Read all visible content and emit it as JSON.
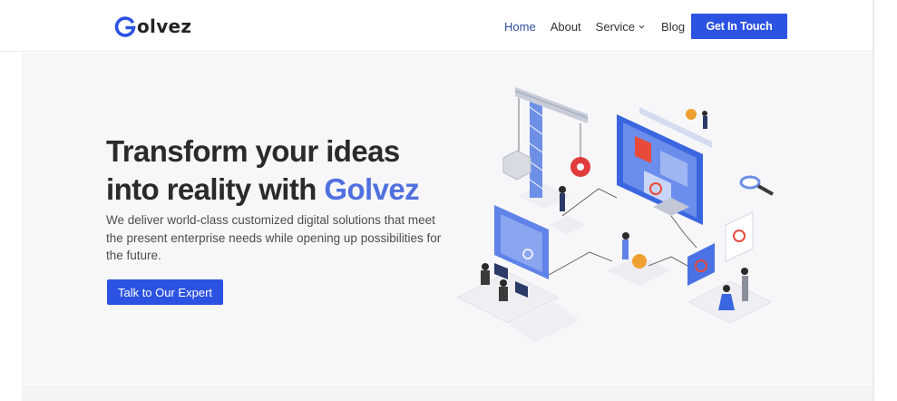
{
  "brand": {
    "logo_text": "olvez",
    "logo_icon": "g-logo-icon",
    "accent_color": "#2b52e1",
    "brand_color": "#5170df"
  },
  "nav": {
    "items": [
      {
        "label": "Home",
        "active": true
      },
      {
        "label": "About",
        "active": false
      },
      {
        "label": "Service",
        "active": false
      },
      {
        "label": "Blog",
        "active": false
      }
    ],
    "service_icon": "chevron-down-icon",
    "cta_label": "Get In Touch"
  },
  "hero": {
    "title_part1": "Transform your ideas into reality with",
    "title_brand": "Golvez",
    "description": "We deliver world-class customized digital solutions that meet the present enterprise needs while opening up possibilities for the future.",
    "button_label": "Talk to Our Expert",
    "illustration": "isometric-digital-solutions-illustration"
  }
}
